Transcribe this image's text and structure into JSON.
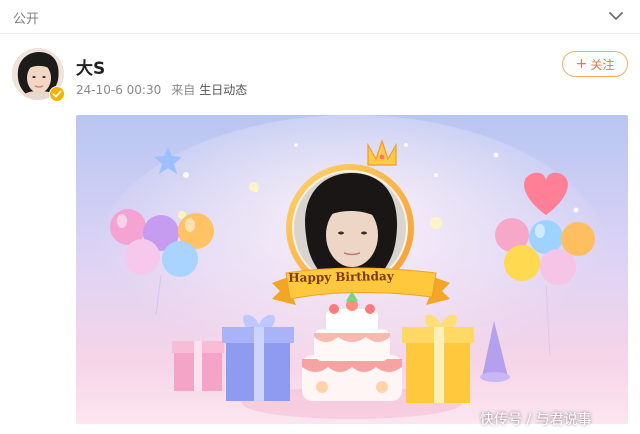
{
  "header": {
    "visibility_label": "公开",
    "chevron_icon": "chevron-down-icon"
  },
  "post": {
    "username": "大S",
    "timestamp": "24-10-6 00:30",
    "source_prefix": "来自",
    "source_link": "生日动态",
    "follow_label": "关注",
    "follow_plus": "+",
    "verified_icon": "verified-badge-icon"
  },
  "banner": {
    "ribbon_text": "Happy Birthday"
  },
  "watermark": {
    "text": "快传号 / 与君说事"
  },
  "colors": {
    "accent": "#eb7350",
    "follow_border": "#f2b06a",
    "verified": "#f5b300"
  }
}
